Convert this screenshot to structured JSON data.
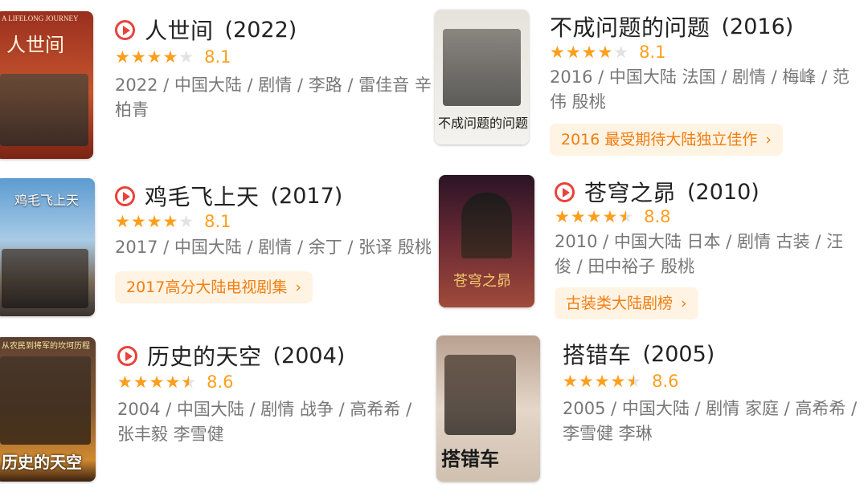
{
  "accent_color": "#e8433b",
  "star_color": "#ff9e1b",
  "movies": [
    {
      "title": "人世间",
      "year": "(2022)",
      "rating": 8.1,
      "stars": 4,
      "rating_text": "8.1",
      "meta": "2022 / 中国大陆 / 剧情 / 李路 / 雷佳音 辛柏青",
      "badge": null,
      "poster": {
        "top_text": "A LIFELONG JOURNEY",
        "title_text": "人世间",
        "colors": [
          "#8a2a1c",
          "#c24a2a"
        ]
      }
    },
    {
      "title": "不成问题的问题",
      "year": "(2016)",
      "rating": 8.1,
      "stars": 4,
      "rating_text": "8.1",
      "meta": "2016 / 中国大陆 法国 / 剧情 / 梅峰 / 范伟 殷桃",
      "badge": "2016 最受期待大陆独立佳作",
      "poster": {
        "top_text": "",
        "title_text": "不成问题的问题",
        "colors": [
          "#d9d6cf",
          "#f1efea"
        ]
      }
    },
    {
      "title": "鸡毛飞上天",
      "year": "(2017)",
      "rating": 8.1,
      "stars": 4,
      "rating_text": "8.1",
      "meta": "2017 / 中国大陆 / 剧情 / 余丁 / 张译 殷桃",
      "badge": "2017高分大陆电视剧集",
      "poster": {
        "top_text": "",
        "title_text": "鸡毛飞上天",
        "colors": [
          "#6aa6d8",
          "#c9dff0"
        ]
      }
    },
    {
      "title": "苍穹之昴",
      "year": "(2010)",
      "rating": 8.8,
      "stars": 4.5,
      "rating_text": "8.8",
      "meta": "2010 / 中国大陆 日本 / 剧情 古装 / 汪俊 / 田中裕子 殷桃",
      "badge": "古装类大陆剧榜",
      "poster": {
        "top_text": "",
        "title_text": "苍穹之昴",
        "colors": [
          "#3a1e2e",
          "#8a3a3a"
        ]
      }
    },
    {
      "title": "历史的天空",
      "year": "(2004)",
      "rating": 8.6,
      "stars": 4.5,
      "rating_text": "8.6",
      "meta": "2004 / 中国大陆 / 剧情 战争 / 高希希 / 张丰毅 李雪健",
      "badge": null,
      "poster": {
        "top_text": "从农民到将军的坎坷历程",
        "title_text": "历史的天空",
        "colors": [
          "#3b2a1a",
          "#b8742a"
        ]
      }
    },
    {
      "title": "搭错车",
      "year": "(2005)",
      "rating": 8.6,
      "stars": 4.5,
      "rating_text": "8.6",
      "meta": "2005 / 中国大陆 / 剧情 家庭 / 高希希 / 李雪健 李琳",
      "badge": null,
      "poster": {
        "top_text": "",
        "title_text": "搭错车",
        "colors": [
          "#c9b8a8",
          "#efe6dc"
        ]
      }
    }
  ]
}
